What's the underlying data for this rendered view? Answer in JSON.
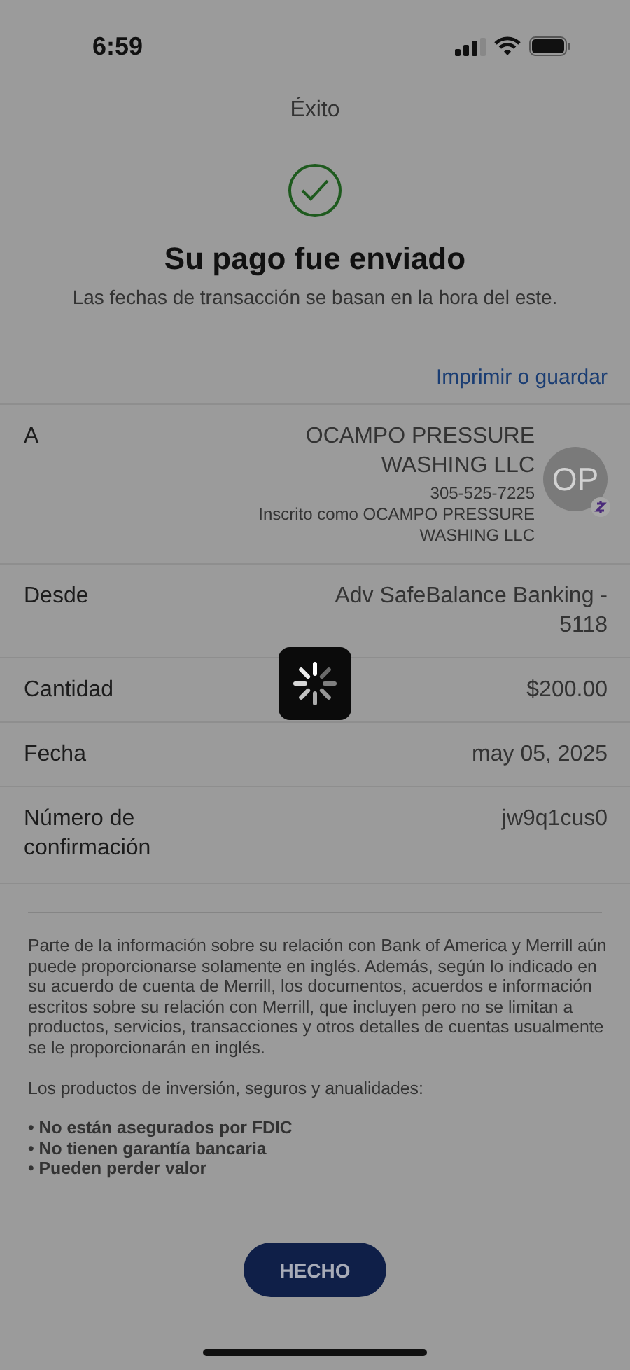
{
  "status_bar": {
    "time": "6:59"
  },
  "header": {
    "title": "Éxito"
  },
  "confirmation": {
    "heading": "Su pago fue enviado",
    "subtitle": "Las fechas de transacción se basan en la hora del este."
  },
  "print_link": "Imprimir o guardar",
  "details": [
    {
      "kind": "payee",
      "label": "A",
      "name": "OCAMPO PRESSURE WASHING LLC",
      "phone": "305-525-7225",
      "enrolled_as": "Inscrito como OCAMPO PRESSURE WASHING LLC",
      "avatar_initials": "OP"
    },
    {
      "kind": "plain",
      "label": "Desde",
      "value": "Adv SafeBalance Banking - 5118"
    },
    {
      "kind": "plain",
      "label": "Cantidad",
      "value": "$200.00"
    },
    {
      "kind": "plain",
      "label": "Fecha",
      "value": "may 05, 2025"
    },
    {
      "kind": "plain",
      "label": "Número de confirmación",
      "value": "jw9q1cus0"
    }
  ],
  "disclaimer": {
    "paragraph": "Parte de la información sobre su relación con Bank of America y Merrill aún puede proporcionarse solamente en inglés. Además, según lo indicado en su acuerdo de cuenta de Merrill, los documentos, acuerdos e información escritos sobre su relación con Merrill, que incluyen pero no se limitan a productos, servicios, transacciones y otros detalles de cuentas usualmente se le proporcionarán en inglés.",
    "intro": "Los productos de inversión, seguros y anualidades:",
    "bullets": [
      "• No están asegurados por FDIC",
      "• No tienen garantía bancaria",
      "• Pueden perder valor"
    ]
  },
  "done_button": "HECHO",
  "loading": true
}
